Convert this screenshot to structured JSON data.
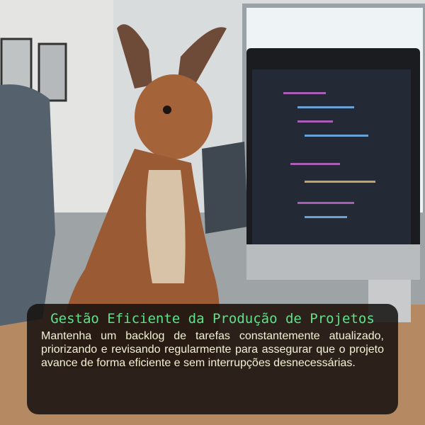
{
  "caption": {
    "title": "Gestão Eficiente da Produção de Projetos",
    "body": "Mantenha um backlog de tarefas constantemente atualizado, priorizando e revisando regularmente para assegurar que o projeto avance de forma eficiente e sem interrupções desnecessárias."
  },
  "colors": {
    "title": "#5fe08a",
    "body": "#f3f1d6",
    "box": "#14100e"
  }
}
